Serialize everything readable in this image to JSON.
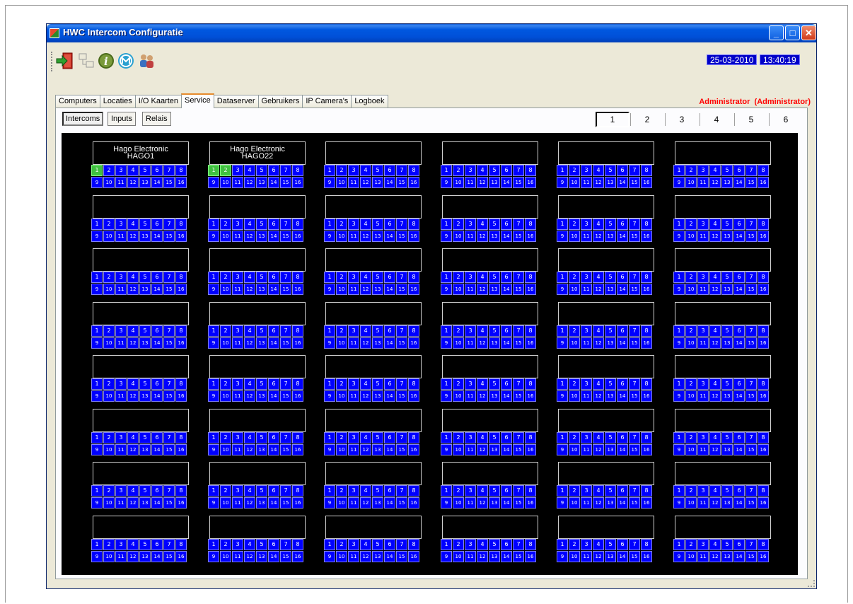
{
  "window": {
    "title": "HWC Intercom Configuratie",
    "minimize": "_",
    "maximize": "□",
    "close": "✕"
  },
  "toolbar": {
    "tools": [
      {
        "name": "exit-icon"
      },
      {
        "name": "network-icon"
      },
      {
        "name": "info-icon"
      },
      {
        "name": "hago-logo-icon"
      },
      {
        "name": "users-icon"
      }
    ],
    "date": "25-03-2010",
    "time": "13:40:19"
  },
  "tabs": [
    "Computers",
    "Locaties",
    "I/O Kaarten",
    "Service",
    "Dataserver",
    "Gebruikers",
    "IP Camera's",
    "Logboek"
  ],
  "active_tab": "Service",
  "user_label": "Administrator  (Administrator)",
  "subtabs": [
    "Intercoms",
    "Inputs",
    "Relais"
  ],
  "active_subtab": "Intercoms",
  "pages": [
    "1",
    "2",
    "3",
    "4",
    "5",
    "6"
  ],
  "active_page": "1",
  "grid": {
    "columns": 6,
    "rows": 8,
    "channel_row1": [
      "1",
      "2",
      "3",
      "4",
      "5",
      "6",
      "7",
      "8"
    ],
    "channel_row2": [
      "9",
      "10",
      "11",
      "12",
      "13",
      "14",
      "15",
      "16"
    ],
    "colors": {
      "channel": "#0000ff",
      "active_channel": "#40c040",
      "background": "#000000"
    },
    "intercoms": [
      {
        "name": "Hago Electronic",
        "id": "HAGO1",
        "active_channels": [
          1
        ]
      },
      {
        "name": "Hago Electronic",
        "id": "HAGO22",
        "active_channels": [
          1,
          2
        ]
      }
    ]
  }
}
